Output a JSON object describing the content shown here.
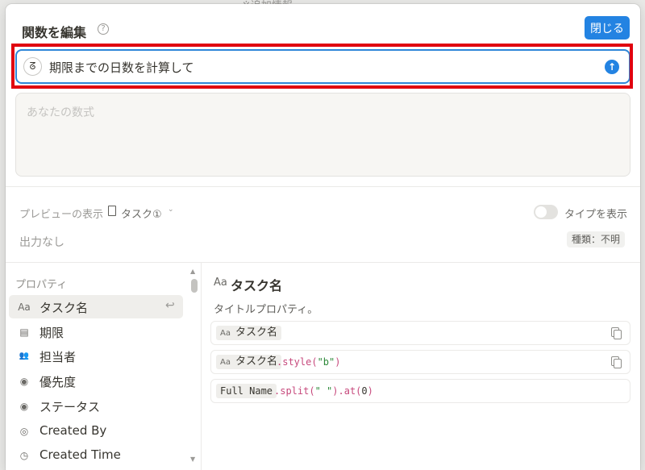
{
  "modal": {
    "title": "関数を編集",
    "help_icon": "question-circle-icon",
    "close_label": "閉じる"
  },
  "ai": {
    "prompt": "期限までの日数を計算して",
    "icon": "ai-face-icon",
    "send_icon": "arrow-up-icon"
  },
  "formula": {
    "placeholder": "あなたの数式"
  },
  "preview": {
    "label": "プレビューの表示",
    "page_name": "タスク①",
    "toggle_label": "タイプを表示",
    "output": "出力なし",
    "type_badge": "種類：不明"
  },
  "properties": {
    "header": "プロパティ",
    "items": [
      {
        "icon": "text-aa-icon",
        "icon_glyph": "Aa",
        "label": "タスク名"
      },
      {
        "icon": "calendar-icon",
        "icon_glyph": "▤",
        "label": "期限"
      },
      {
        "icon": "people-icon",
        "icon_glyph": "👥",
        "label": "担当者"
      },
      {
        "icon": "select-icon",
        "icon_glyph": "◉",
        "label": "優先度"
      },
      {
        "icon": "status-icon",
        "icon_glyph": "◉",
        "label": "ステータス"
      },
      {
        "icon": "user-circle-icon",
        "icon_glyph": "◎",
        "label": "Created By"
      },
      {
        "icon": "clock-icon",
        "icon_glyph": "◷",
        "label": "Created Time"
      }
    ]
  },
  "detail": {
    "aa": "Aa",
    "title": "タスク名",
    "description": "タイトルプロパティ。",
    "examples": [
      {
        "chip_aa": "Aa",
        "chip": "タスク名"
      },
      {
        "chip_aa": "Aa",
        "chip": "タスク名",
        "method": ".style(",
        "arg": "\"b\"",
        "close": ")"
      },
      {
        "chip": "Full Name",
        "method": ".split(",
        "arg": "\" \"",
        "mid": ").at(",
        "num": "0",
        "close": ")"
      }
    ]
  },
  "colors": {
    "accent": "#2383e2",
    "highlight": "#e0000f"
  },
  "background": {
    "fragment": "※追加情報"
  }
}
